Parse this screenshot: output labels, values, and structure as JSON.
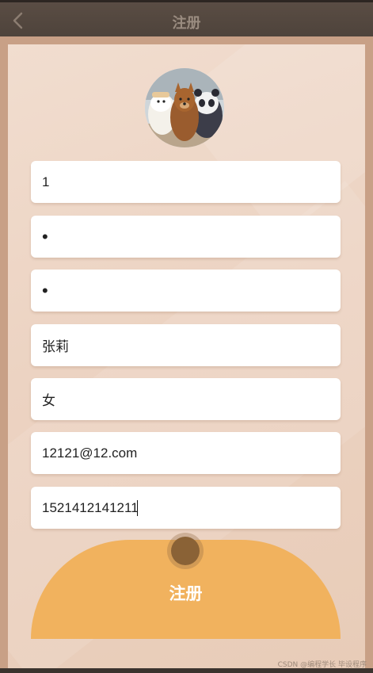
{
  "header": {
    "title": "注册"
  },
  "form": {
    "username": "1",
    "password": "•",
    "confirm_password": "•",
    "name": "张莉",
    "gender": "女",
    "email": "12121@12.com",
    "phone": "1521412141211"
  },
  "register_button": {
    "label": "注册"
  },
  "watermark": "CSDN @编程学长 毕设程序",
  "colors": {
    "accent": "#f1b25e",
    "topbar": "#4e433b"
  },
  "icons": {
    "back": "chevron-left-icon",
    "avatar": "avatar-illustration"
  }
}
